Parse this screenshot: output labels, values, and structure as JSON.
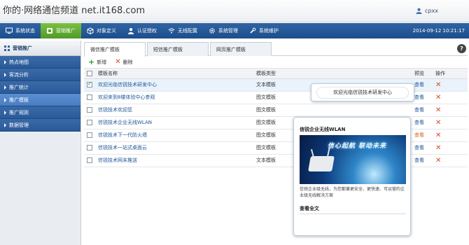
{
  "watermark": "你的·网络通信频道 net.it168.com",
  "header": {
    "user": "cpxx",
    "datetime": "2014-09-12 10:21:17"
  },
  "nav": [
    {
      "label": "系统状态",
      "icon": "monitor-icon",
      "active": false
    },
    {
      "label": "营销推广",
      "icon": "marketing-icon",
      "active": true
    },
    {
      "label": "对象定义",
      "icon": "cube-icon",
      "active": false
    },
    {
      "label": "认证授权",
      "icon": "user-auth-icon",
      "active": false
    },
    {
      "label": "无线配置",
      "icon": "wireless-icon",
      "active": false
    },
    {
      "label": "系统管理",
      "icon": "gear-icon",
      "active": false
    },
    {
      "label": "系统维护",
      "icon": "wrench-icon",
      "active": false
    }
  ],
  "sidebar": {
    "title": "营销推广",
    "items": [
      {
        "label": "热点地图",
        "active": false
      },
      {
        "label": "客流分析",
        "active": false
      },
      {
        "label": "推广统计",
        "active": false
      },
      {
        "label": "推广模板",
        "active": true
      },
      {
        "label": "推广规则",
        "active": false
      },
      {
        "label": "数据管理",
        "active": false
      }
    ]
  },
  "tabs": [
    {
      "label": "微信推广模板",
      "active": true
    },
    {
      "label": "短信推广模板",
      "active": false
    },
    {
      "label": "网页推广模板",
      "active": false
    }
  ],
  "toolbar": {
    "add_label": "新增",
    "delete_label": "删除"
  },
  "table": {
    "headers": {
      "name": "模板名称",
      "type": "模板类型",
      "preview": "预览",
      "action": "操作"
    },
    "rows": [
      {
        "name": "欢迎光临信锐技术研发中心",
        "type": "文本模板",
        "view": "查看",
        "checked": true
      },
      {
        "name": "欢迎来到8楼体验中心参观",
        "type": "图文模板",
        "view": "查看",
        "checked": false
      },
      {
        "name": "信锐技术欢迎您",
        "type": "图文模板",
        "view": "查看",
        "checked": false
      },
      {
        "name": "信锐技术企业无线WLAN",
        "type": "图文模板",
        "view": "查看",
        "checked": false
      },
      {
        "name": "信锐技术下一代防火墙",
        "type": "图文模板",
        "view": "查看",
        "checked": false
      },
      {
        "name": "信锐技术一站式桌面云",
        "type": "图文模板",
        "view": "查看",
        "checked": false
      },
      {
        "name": "信锐技术网末推送",
        "type": "文本模板",
        "view": "查看",
        "checked": false
      }
    ]
  },
  "tooltip": {
    "text": "欢迎光临信锐技术研发中心"
  },
  "preview_card": {
    "title": "信锐企业无线WLAN",
    "banner_text": "信心起航  联动未来",
    "description": "信锐企业级无线，为您都兼更安全、更快速、可运营的企业级无线解决方案",
    "more": "查看全文"
  }
}
